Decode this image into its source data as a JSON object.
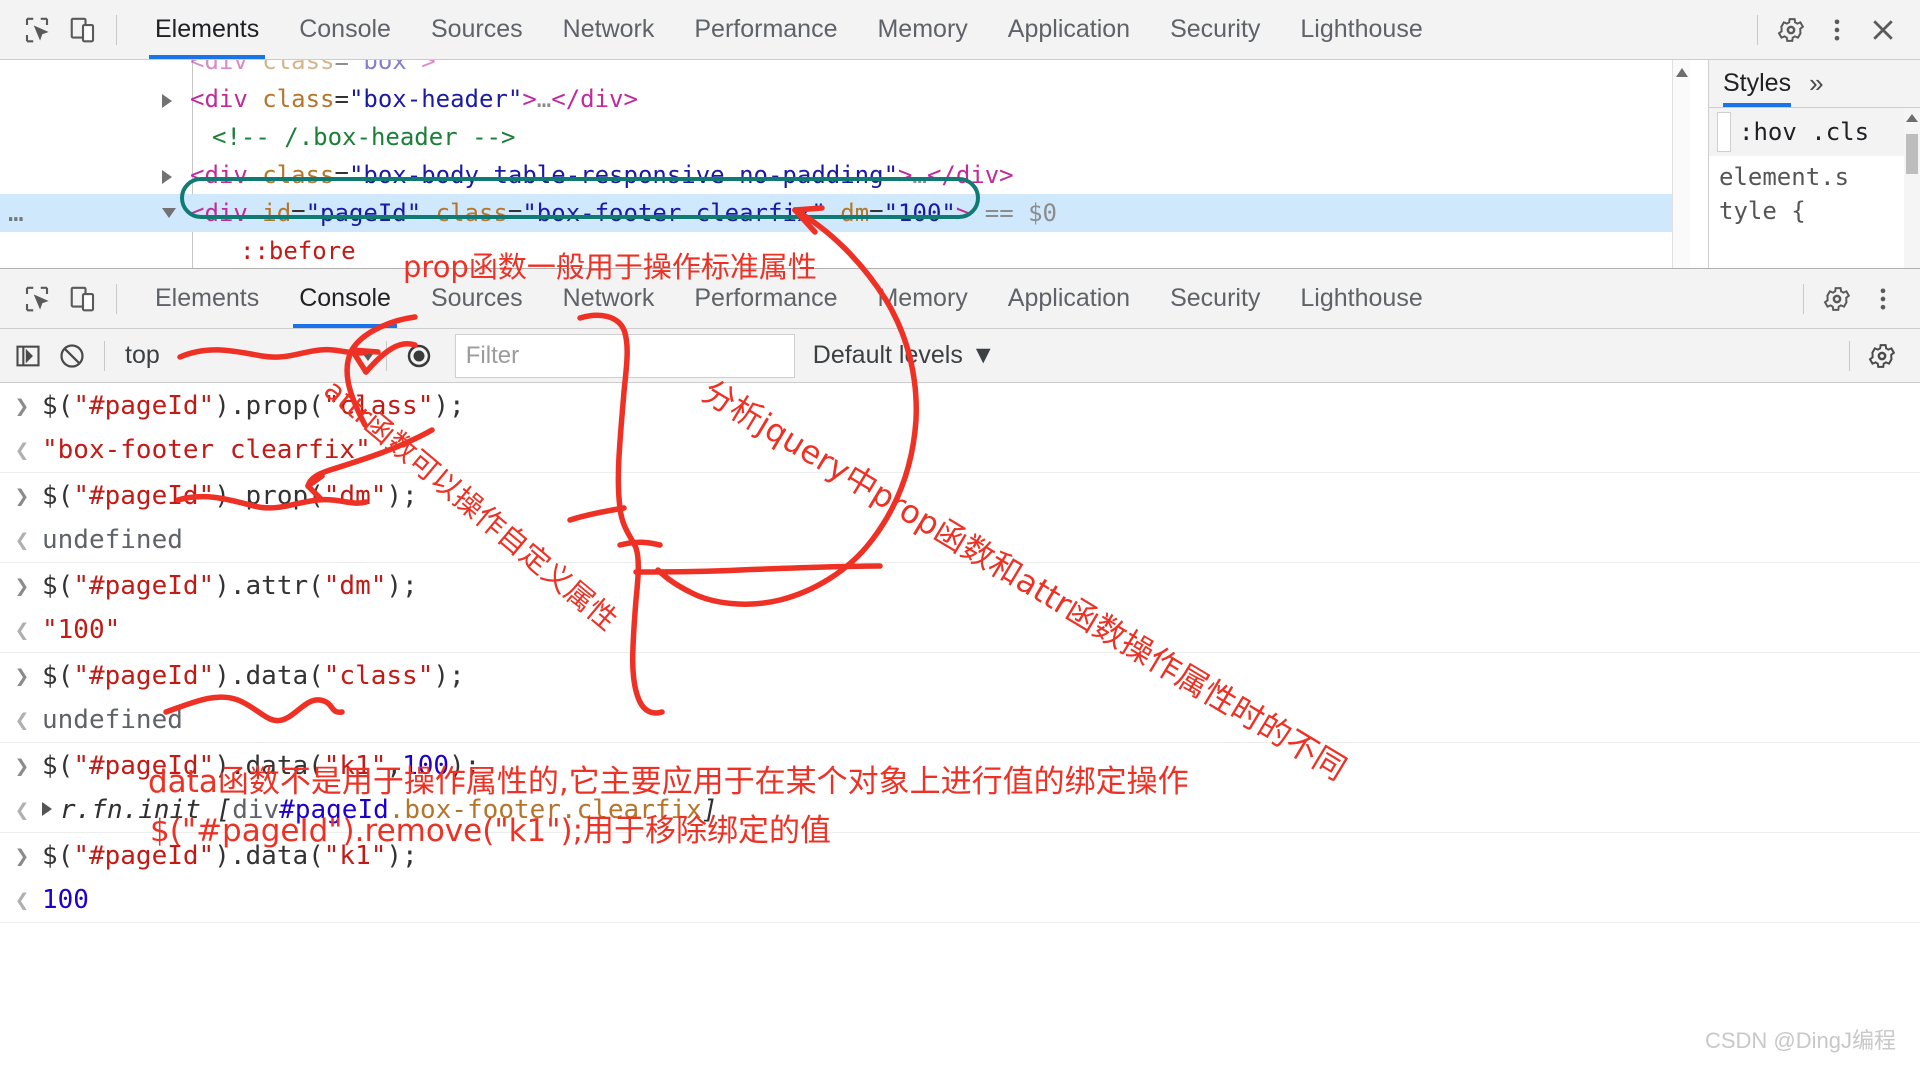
{
  "elements_panel": {
    "toolbar": {
      "icons": [
        {
          "name": "inspect-element-icon",
          "glyph": "inspect"
        },
        {
          "name": "device-toolbar-icon",
          "glyph": "device"
        }
      ],
      "tabs": [
        {
          "label": "Elements",
          "active": true
        },
        {
          "label": "Console",
          "active": false
        },
        {
          "label": "Sources",
          "active": false
        },
        {
          "label": "Network",
          "active": false
        },
        {
          "label": "Performance",
          "active": false
        },
        {
          "label": "Memory",
          "active": false
        },
        {
          "label": "Application",
          "active": false
        },
        {
          "label": "Security",
          "active": false
        },
        {
          "label": "Lighthouse",
          "active": false
        }
      ],
      "right_icons": [
        {
          "name": "settings-gear-icon"
        },
        {
          "name": "more-options-icon"
        },
        {
          "name": "close-devtools-icon"
        }
      ]
    },
    "dom_lines": [
      {
        "kind": "clipped",
        "tokens": [
          {
            "t": "<div ",
            "c": "tk-pink"
          },
          {
            "t": "class",
            "c": "tk-orange"
          },
          {
            "t": "=",
            "c": "tk-dark"
          },
          {
            "t": "\"box\"",
            "c": "tk-blue"
          },
          {
            "t": ">",
            "c": "tk-pink"
          }
        ]
      },
      {
        "kind": "node",
        "triangle": "closed",
        "tokens": [
          {
            "t": "<div ",
            "c": "tk-pink"
          },
          {
            "t": "class",
            "c": "tk-orange"
          },
          {
            "t": "=",
            "c": "tk-dark"
          },
          {
            "t": "\"box-header\"",
            "c": "tk-blue"
          },
          {
            "t": ">",
            "c": "tk-pink"
          },
          {
            "t": "…",
            "c": "tk-grey"
          },
          {
            "t": "</div>",
            "c": "tk-pink"
          }
        ]
      },
      {
        "kind": "comment",
        "tokens": [
          {
            "t": "<!-- /.box-header -->",
            "c": "tk-green"
          }
        ]
      },
      {
        "kind": "node",
        "triangle": "closed",
        "tokens": [
          {
            "t": "<div ",
            "c": "tk-pink"
          },
          {
            "t": "class",
            "c": "tk-orange"
          },
          {
            "t": "=",
            "c": "tk-dark"
          },
          {
            "t": "\"box-body table-responsive no-padding\"",
            "c": "tk-blue"
          },
          {
            "t": ">",
            "c": "tk-pink"
          },
          {
            "t": "…",
            "c": "tk-grey"
          },
          {
            "t": "</div>",
            "c": "tk-pink"
          }
        ]
      },
      {
        "kind": "node",
        "triangle": "open",
        "selected": true,
        "gutter_dots": "…",
        "tokens": [
          {
            "t": "<div ",
            "c": "tk-pink"
          },
          {
            "t": "id",
            "c": "tk-orange"
          },
          {
            "t": "=",
            "c": "tk-dark"
          },
          {
            "t": "\"pageId\"",
            "c": "tk-blue"
          },
          {
            "t": " ",
            "c": "tk-dark"
          },
          {
            "t": "class",
            "c": "tk-orange"
          },
          {
            "t": "=",
            "c": "tk-dark"
          },
          {
            "t": "\"box-footer clearfix\"",
            "c": "tk-blue"
          },
          {
            "t": " ",
            "c": "tk-dark"
          },
          {
            "t": "dm",
            "c": "tk-orange"
          },
          {
            "t": "=",
            "c": "tk-dark"
          },
          {
            "t": "\"100\"",
            "c": "tk-blue"
          },
          {
            "t": ">",
            "c": "tk-pink"
          },
          {
            "t": " == ",
            "c": "tk-grey"
          },
          {
            "t": "$0",
            "c": "tk-grey"
          }
        ]
      },
      {
        "kind": "pseudo",
        "tokens": [
          {
            "t": "::before",
            "c": "tk-red"
          }
        ]
      }
    ]
  },
  "styles_pane": {
    "tab_label": "Styles",
    "more_glyph": "»",
    "filter_row": ":hov  .cls",
    "body_lines": [
      "element.s",
      "tyle {"
    ]
  },
  "console_panel": {
    "toolbar": {
      "icons": [
        {
          "name": "inspect-element-icon"
        },
        {
          "name": "device-toolbar-icon"
        }
      ],
      "tabs": [
        {
          "label": "Elements",
          "active": false
        },
        {
          "label": "Console",
          "active": true
        },
        {
          "label": "Sources",
          "active": false
        },
        {
          "label": "Network",
          "active": false
        },
        {
          "label": "Performance",
          "active": false
        },
        {
          "label": "Memory",
          "active": false
        },
        {
          "label": "Application",
          "active": false
        },
        {
          "label": "Security",
          "active": false
        },
        {
          "label": "Lighthouse",
          "active": false
        }
      ],
      "right_icons": [
        {
          "name": "settings-gear-icon"
        },
        {
          "name": "more-options-icon"
        }
      ]
    },
    "filter_bar": {
      "sidebar_toggle": "show-console-sidebar-icon",
      "clear_icon": "clear-console-icon",
      "context_label": "top",
      "eye_icon": "live-expression-icon",
      "filter_placeholder": "Filter",
      "levels_label": "Default levels",
      "levels_caret": "▼",
      "settings_icon": "console-settings-icon"
    },
    "log": [
      {
        "type": "input",
        "marker": ">",
        "segments": [
          {
            "t": "$(",
            "c": "tk-dark"
          },
          {
            "t": "\"#pageId\"",
            "c": "val-str"
          },
          {
            "t": ").prop(",
            "c": "tk-dark"
          },
          {
            "t": "\"class\"",
            "c": "val-str"
          },
          {
            "t": ");",
            "c": "tk-dark"
          }
        ]
      },
      {
        "type": "output",
        "marker": "<",
        "segments": [
          {
            "t": "\"box-footer clearfix\"",
            "c": "val-str"
          }
        ]
      },
      {
        "type": "input",
        "marker": ">",
        "segments": [
          {
            "t": "$(",
            "c": "tk-dark"
          },
          {
            "t": "\"#pageId\"",
            "c": "val-str"
          },
          {
            "t": ").prop(",
            "c": "tk-dark"
          },
          {
            "t": "\"dm\"",
            "c": "val-str"
          },
          {
            "t": ");",
            "c": "tk-dark"
          }
        ]
      },
      {
        "type": "output",
        "marker": "<",
        "segments": [
          {
            "t": "undefined",
            "c": "val-undef"
          }
        ]
      },
      {
        "type": "input",
        "marker": ">",
        "segments": [
          {
            "t": "$(",
            "c": "tk-dark"
          },
          {
            "t": "\"#pageId\"",
            "c": "val-str"
          },
          {
            "t": ").attr(",
            "c": "tk-dark"
          },
          {
            "t": "\"dm\"",
            "c": "val-str"
          },
          {
            "t": ");",
            "c": "tk-dark"
          }
        ]
      },
      {
        "type": "output",
        "marker": "<",
        "segments": [
          {
            "t": "\"100\"",
            "c": "val-str"
          }
        ]
      },
      {
        "type": "input",
        "marker": ">",
        "segments": [
          {
            "t": "$(",
            "c": "tk-dark"
          },
          {
            "t": "\"#pageId\"",
            "c": "val-str"
          },
          {
            "t": ").data(",
            "c": "tk-dark"
          },
          {
            "t": "\"class\"",
            "c": "val-str"
          },
          {
            "t": ");",
            "c": "tk-dark"
          }
        ]
      },
      {
        "type": "output",
        "marker": "<",
        "segments": [
          {
            "t": "undefined",
            "c": "val-undef"
          }
        ]
      },
      {
        "type": "input",
        "marker": ">",
        "segments": [
          {
            "t": "$(",
            "c": "tk-dark"
          },
          {
            "t": "\"#pageId\"",
            "c": "val-str"
          },
          {
            "t": ").data(",
            "c": "tk-dark"
          },
          {
            "t": "\"k1\"",
            "c": "val-str"
          },
          {
            "t": ",",
            "c": "tk-dark"
          },
          {
            "t": "100",
            "c": "val-num"
          },
          {
            "t": ");",
            "c": "tk-dark"
          }
        ]
      },
      {
        "type": "output",
        "marker": "<",
        "expandable": true,
        "segments": [
          {
            "t": "r.fn.init ",
            "c": "obj-italic"
          },
          {
            "t": "[",
            "c": "obj-italic"
          },
          {
            "t": "div",
            "c": "val-undef"
          },
          {
            "t": "#pageId",
            "c": "val-num"
          },
          {
            "t": ".box-footer.clearfix",
            "c": "tk-orange"
          },
          {
            "t": "]",
            "c": "obj-italic"
          }
        ]
      },
      {
        "type": "input",
        "marker": ">",
        "segments": [
          {
            "t": "$(",
            "c": "tk-dark"
          },
          {
            "t": "\"#pageId\"",
            "c": "val-str"
          },
          {
            "t": ").data(",
            "c": "tk-dark"
          },
          {
            "t": "\"k1\"",
            "c": "val-str"
          },
          {
            "t": ");",
            "c": "tk-dark"
          }
        ]
      },
      {
        "type": "output",
        "marker": "<",
        "segments": [
          {
            "t": "100",
            "c": "val-num"
          }
        ]
      }
    ]
  },
  "annotations": {
    "color": "#ee3124",
    "texts": [
      {
        "id": "note_prop",
        "text": "prop函数一般用于操作标准属性"
      },
      {
        "id": "note_attr",
        "text": "attr函数可以操作自定义属性"
      },
      {
        "id": "note_compare",
        "text": "分析jquery中prop函数和attr函数操作属性时的不同"
      },
      {
        "id": "note_data_1",
        "text": "data函数不是用于操作属性的,它主要应用于在某个对象上进行值的绑定操作"
      },
      {
        "id": "note_data_2",
        "text": "$(\"#pageId\").remove(\"k1\");用于移除绑定的值"
      }
    ]
  },
  "watermark": {
    "text": "CSDN @DingJ编程"
  }
}
